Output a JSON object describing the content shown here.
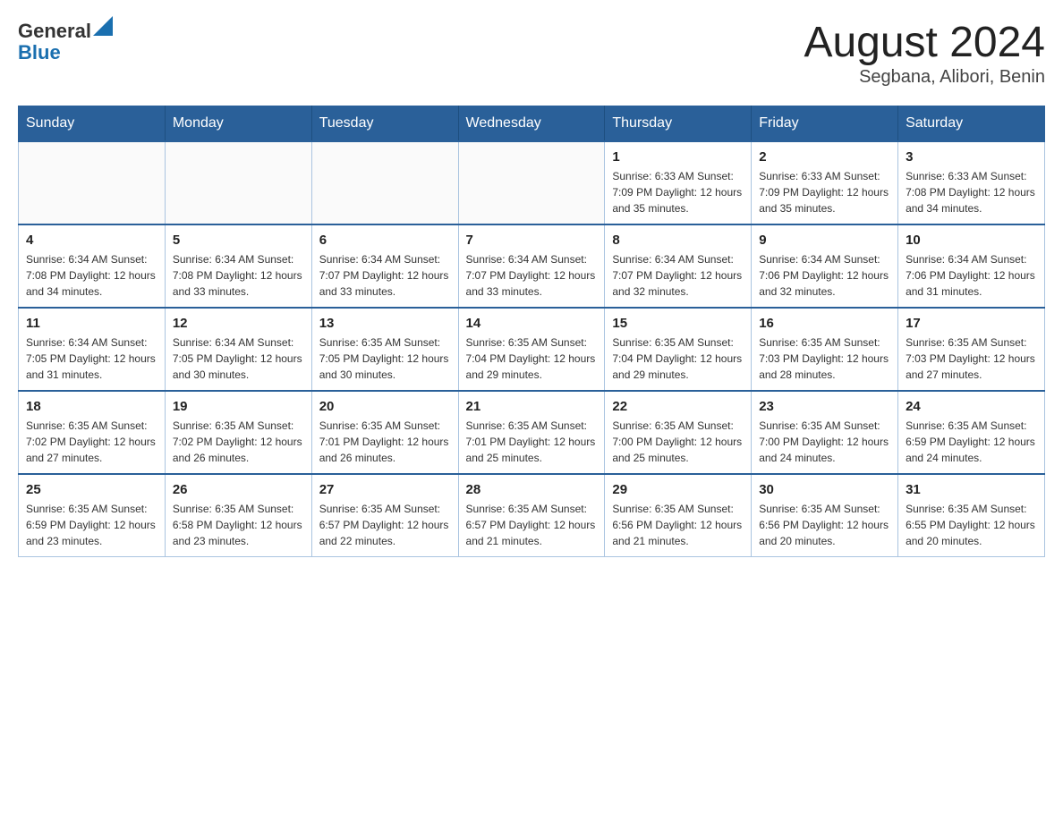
{
  "header": {
    "logo_general": "General",
    "logo_blue": "Blue",
    "title": "August 2024",
    "subtitle": "Segbana, Alibori, Benin"
  },
  "days_of_week": [
    "Sunday",
    "Monday",
    "Tuesday",
    "Wednesday",
    "Thursday",
    "Friday",
    "Saturday"
  ],
  "weeks": [
    [
      {
        "day": "",
        "info": ""
      },
      {
        "day": "",
        "info": ""
      },
      {
        "day": "",
        "info": ""
      },
      {
        "day": "",
        "info": ""
      },
      {
        "day": "1",
        "info": "Sunrise: 6:33 AM\nSunset: 7:09 PM\nDaylight: 12 hours\nand 35 minutes."
      },
      {
        "day": "2",
        "info": "Sunrise: 6:33 AM\nSunset: 7:09 PM\nDaylight: 12 hours\nand 35 minutes."
      },
      {
        "day": "3",
        "info": "Sunrise: 6:33 AM\nSunset: 7:08 PM\nDaylight: 12 hours\nand 34 minutes."
      }
    ],
    [
      {
        "day": "4",
        "info": "Sunrise: 6:34 AM\nSunset: 7:08 PM\nDaylight: 12 hours\nand 34 minutes."
      },
      {
        "day": "5",
        "info": "Sunrise: 6:34 AM\nSunset: 7:08 PM\nDaylight: 12 hours\nand 33 minutes."
      },
      {
        "day": "6",
        "info": "Sunrise: 6:34 AM\nSunset: 7:07 PM\nDaylight: 12 hours\nand 33 minutes."
      },
      {
        "day": "7",
        "info": "Sunrise: 6:34 AM\nSunset: 7:07 PM\nDaylight: 12 hours\nand 33 minutes."
      },
      {
        "day": "8",
        "info": "Sunrise: 6:34 AM\nSunset: 7:07 PM\nDaylight: 12 hours\nand 32 minutes."
      },
      {
        "day": "9",
        "info": "Sunrise: 6:34 AM\nSunset: 7:06 PM\nDaylight: 12 hours\nand 32 minutes."
      },
      {
        "day": "10",
        "info": "Sunrise: 6:34 AM\nSunset: 7:06 PM\nDaylight: 12 hours\nand 31 minutes."
      }
    ],
    [
      {
        "day": "11",
        "info": "Sunrise: 6:34 AM\nSunset: 7:05 PM\nDaylight: 12 hours\nand 31 minutes."
      },
      {
        "day": "12",
        "info": "Sunrise: 6:34 AM\nSunset: 7:05 PM\nDaylight: 12 hours\nand 30 minutes."
      },
      {
        "day": "13",
        "info": "Sunrise: 6:35 AM\nSunset: 7:05 PM\nDaylight: 12 hours\nand 30 minutes."
      },
      {
        "day": "14",
        "info": "Sunrise: 6:35 AM\nSunset: 7:04 PM\nDaylight: 12 hours\nand 29 minutes."
      },
      {
        "day": "15",
        "info": "Sunrise: 6:35 AM\nSunset: 7:04 PM\nDaylight: 12 hours\nand 29 minutes."
      },
      {
        "day": "16",
        "info": "Sunrise: 6:35 AM\nSunset: 7:03 PM\nDaylight: 12 hours\nand 28 minutes."
      },
      {
        "day": "17",
        "info": "Sunrise: 6:35 AM\nSunset: 7:03 PM\nDaylight: 12 hours\nand 27 minutes."
      }
    ],
    [
      {
        "day": "18",
        "info": "Sunrise: 6:35 AM\nSunset: 7:02 PM\nDaylight: 12 hours\nand 27 minutes."
      },
      {
        "day": "19",
        "info": "Sunrise: 6:35 AM\nSunset: 7:02 PM\nDaylight: 12 hours\nand 26 minutes."
      },
      {
        "day": "20",
        "info": "Sunrise: 6:35 AM\nSunset: 7:01 PM\nDaylight: 12 hours\nand 26 minutes."
      },
      {
        "day": "21",
        "info": "Sunrise: 6:35 AM\nSunset: 7:01 PM\nDaylight: 12 hours\nand 25 minutes."
      },
      {
        "day": "22",
        "info": "Sunrise: 6:35 AM\nSunset: 7:00 PM\nDaylight: 12 hours\nand 25 minutes."
      },
      {
        "day": "23",
        "info": "Sunrise: 6:35 AM\nSunset: 7:00 PM\nDaylight: 12 hours\nand 24 minutes."
      },
      {
        "day": "24",
        "info": "Sunrise: 6:35 AM\nSunset: 6:59 PM\nDaylight: 12 hours\nand 24 minutes."
      }
    ],
    [
      {
        "day": "25",
        "info": "Sunrise: 6:35 AM\nSunset: 6:59 PM\nDaylight: 12 hours\nand 23 minutes."
      },
      {
        "day": "26",
        "info": "Sunrise: 6:35 AM\nSunset: 6:58 PM\nDaylight: 12 hours\nand 23 minutes."
      },
      {
        "day": "27",
        "info": "Sunrise: 6:35 AM\nSunset: 6:57 PM\nDaylight: 12 hours\nand 22 minutes."
      },
      {
        "day": "28",
        "info": "Sunrise: 6:35 AM\nSunset: 6:57 PM\nDaylight: 12 hours\nand 21 minutes."
      },
      {
        "day": "29",
        "info": "Sunrise: 6:35 AM\nSunset: 6:56 PM\nDaylight: 12 hours\nand 21 minutes."
      },
      {
        "day": "30",
        "info": "Sunrise: 6:35 AM\nSunset: 6:56 PM\nDaylight: 12 hours\nand 20 minutes."
      },
      {
        "day": "31",
        "info": "Sunrise: 6:35 AM\nSunset: 6:55 PM\nDaylight: 12 hours\nand 20 minutes."
      }
    ]
  ]
}
